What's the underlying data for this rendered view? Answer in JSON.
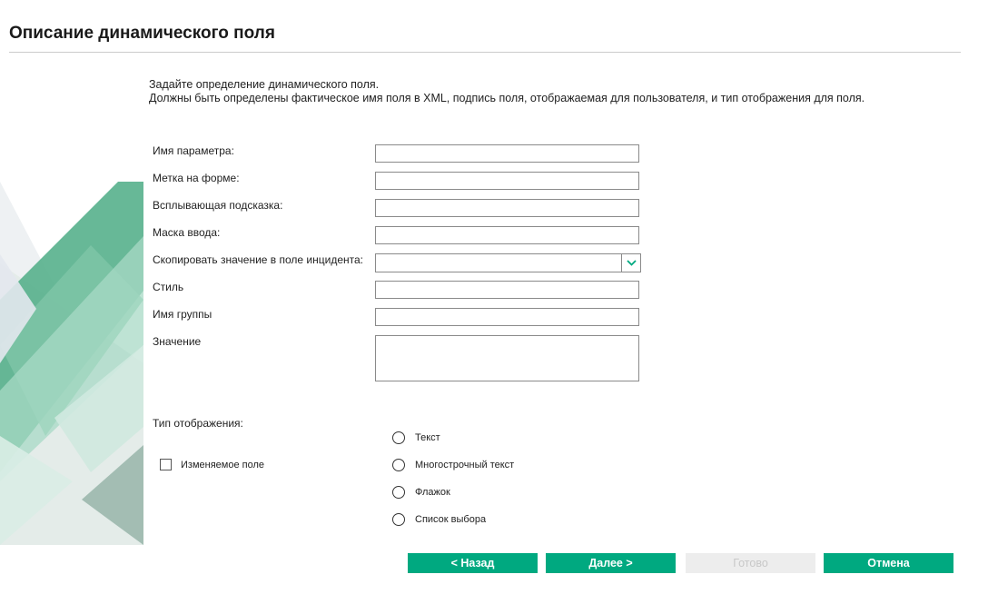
{
  "page": {
    "title": "Описание динамического поля",
    "intro_line1": "Задайте определение динамического поля.",
    "intro_line2": "Должны быть определены фактическое имя поля в XML, подпись поля, отображаемая для пользователя, и тип отображения для поля."
  },
  "form": {
    "param_name": {
      "label": "Имя параметра:",
      "value": ""
    },
    "form_label": {
      "label": "Метка на форме:",
      "value": ""
    },
    "tooltip": {
      "label": "Всплывающая подсказка:",
      "value": ""
    },
    "input_mask": {
      "label": "Маска ввода:",
      "value": ""
    },
    "copy_to_incident": {
      "label": "Скопировать значение в поле инцидента:",
      "value": ""
    },
    "style": {
      "label": "Стиль",
      "value": ""
    },
    "group_name": {
      "label": "Имя группы",
      "value": ""
    },
    "value": {
      "label": "Значение",
      "value": ""
    }
  },
  "display_type": {
    "label": "Тип отображения:",
    "options": [
      "Текст",
      "Многострочный текст",
      "Флажок",
      "Список выбора"
    ],
    "selected": null
  },
  "editable": {
    "label": "Изменяемое поле",
    "checked": false
  },
  "buttons": {
    "back": "< Назад",
    "next": "Далее >",
    "finish": "Готово",
    "cancel": "Отмена"
  },
  "colors": {
    "accent": "#00a980",
    "disabled_bg": "#ededed",
    "disabled_text": "#c8c8c8"
  },
  "icons": {
    "dropdown": "chevron-down-icon"
  }
}
